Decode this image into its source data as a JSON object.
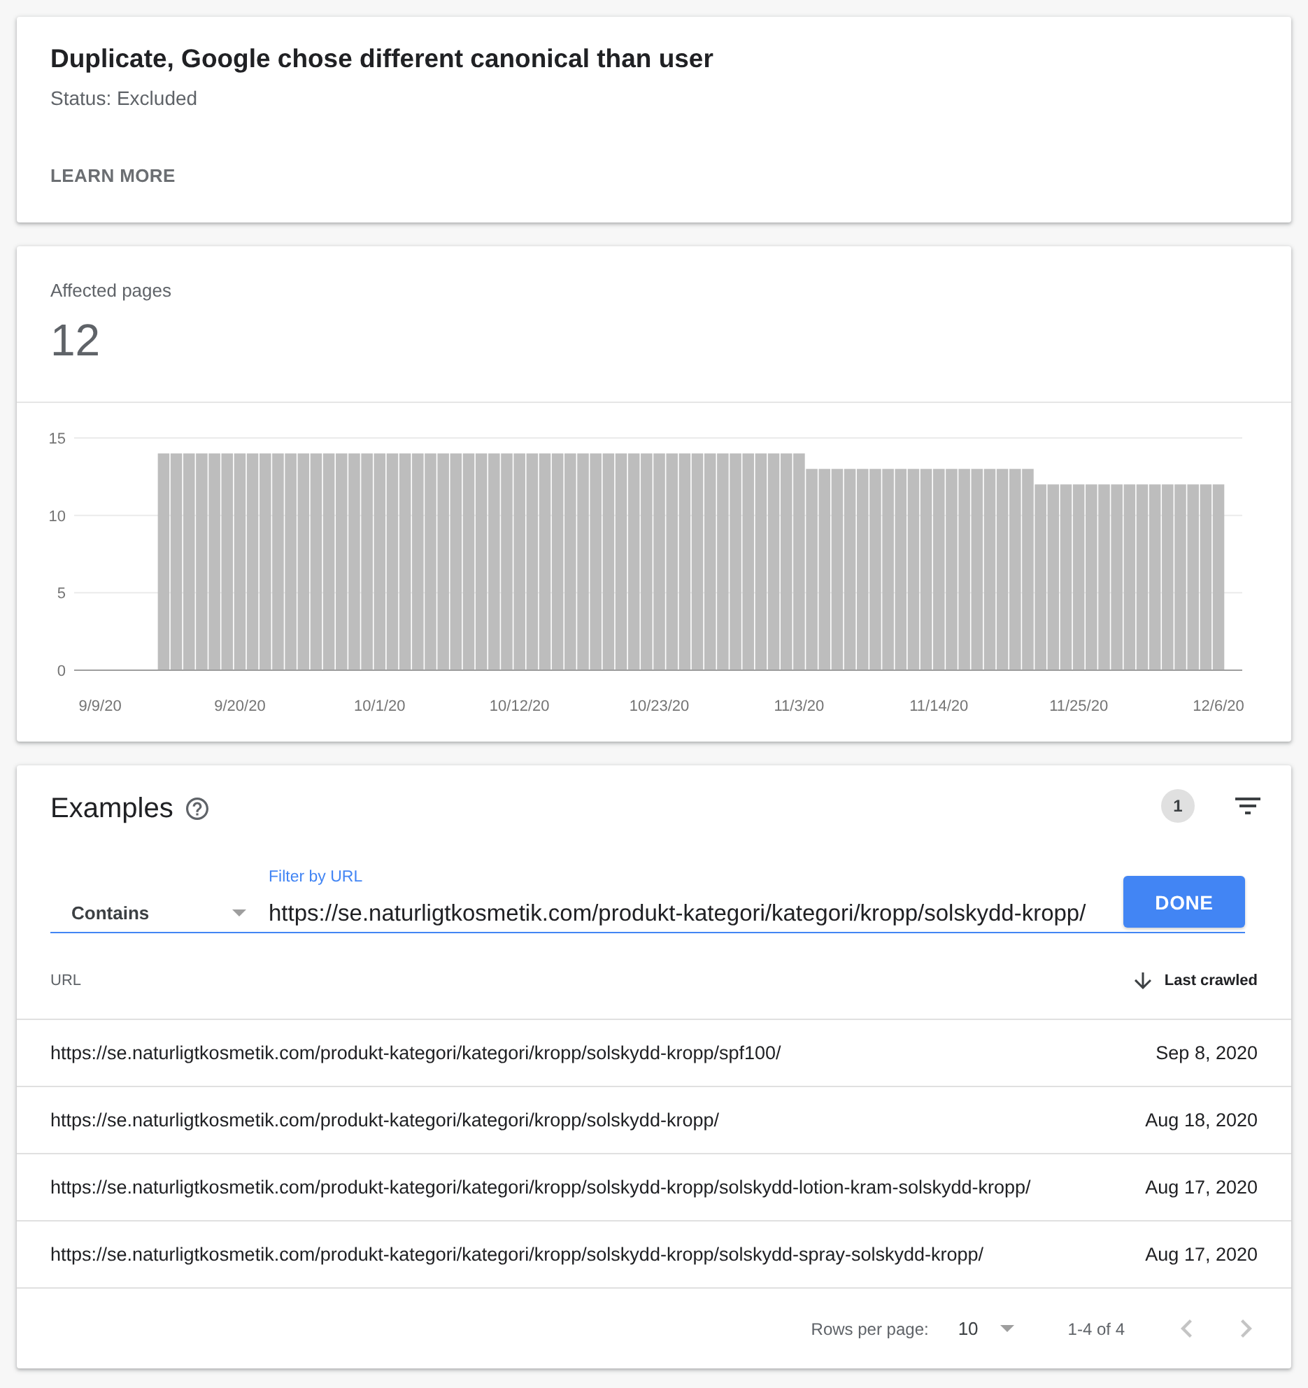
{
  "issue": {
    "title": "Duplicate, Google chose different canonical than user",
    "status": "Status: Excluded",
    "learn_more": "LEARN MORE"
  },
  "affected": {
    "label": "Affected pages",
    "count": "12",
    "chart_data": {
      "type": "bar",
      "categories": [
        "9/9/20",
        null,
        null,
        null,
        null,
        null,
        null,
        null,
        null,
        null,
        null,
        "9/20/20",
        null,
        null,
        null,
        null,
        null,
        null,
        null,
        null,
        null,
        null,
        "10/1/20",
        null,
        null,
        null,
        null,
        null,
        null,
        null,
        null,
        null,
        null,
        "10/12/20",
        null,
        null,
        null,
        null,
        null,
        null,
        null,
        null,
        null,
        null,
        "10/23/20",
        null,
        null,
        null,
        null,
        null,
        null,
        null,
        null,
        null,
        null,
        "11/3/20",
        null,
        null,
        null,
        null,
        null,
        null,
        null,
        null,
        null,
        null,
        "11/14/20",
        null,
        null,
        null,
        null,
        null,
        null,
        null,
        null,
        null,
        null,
        "11/25/20",
        null,
        null,
        null,
        null,
        null,
        null,
        null,
        null,
        null,
        null,
        "12/6/20"
      ],
      "values": [
        null,
        null,
        null,
        null,
        null,
        14,
        14,
        14,
        14,
        14,
        14,
        14,
        14,
        14,
        14,
        14,
        14,
        14,
        14,
        14,
        14,
        14,
        14,
        14,
        14,
        14,
        14,
        14,
        14,
        14,
        14,
        14,
        14,
        14,
        14,
        14,
        14,
        14,
        14,
        14,
        14,
        14,
        14,
        14,
        14,
        14,
        14,
        14,
        14,
        14,
        14,
        14,
        14,
        14,
        14,
        14,
        13,
        13,
        13,
        13,
        13,
        13,
        13,
        13,
        13,
        13,
        13,
        13,
        13,
        13,
        13,
        13,
        13,
        13,
        12,
        12,
        12,
        12,
        12,
        12,
        12,
        12,
        12,
        12,
        12,
        12,
        12,
        12,
        12
      ],
      "ylim": [
        0,
        15
      ],
      "yticks": [
        0,
        5,
        10,
        15
      ]
    }
  },
  "examples": {
    "title": "Examples",
    "filter_count": "1",
    "filter": {
      "operator": "Contains",
      "label": "Filter by URL",
      "value": "https://se.naturligtkosmetik.com/produkt-kategori/kategori/kropp/solskydd-kropp/",
      "focused": true,
      "done": "DONE"
    },
    "table": {
      "columns": [
        {
          "label": "URL",
          "sorted": false
        },
        {
          "label": "Last crawled",
          "sorted": true
        }
      ],
      "rows": [
        {
          "url": "https://se.naturligtkosmetik.com/produkt-kategori/kategori/kropp/solskydd-kropp/spf100/",
          "last_crawled": "Sep 8, 2020"
        },
        {
          "url": "https://se.naturligtkosmetik.com/produkt-kategori/kategori/kropp/solskydd-kropp/",
          "last_crawled": "Aug 18, 2020"
        },
        {
          "url": "https://se.naturligtkosmetik.com/produkt-kategori/kategori/kropp/solskydd-kropp/solskydd-lotion-kram-solskydd-kropp/",
          "last_crawled": "Aug 17, 2020"
        },
        {
          "url": "https://se.naturligtkosmetik.com/produkt-kategori/kategori/kropp/solskydd-kropp/solskydd-spray-solskydd-kropp/",
          "last_crawled": "Aug 17, 2020"
        }
      ]
    },
    "pagination": {
      "rows_per_page_label": "Rows per page:",
      "rows_per_page": "10",
      "range": "1-4 of 4",
      "previous": {
        "disabled": true
      },
      "next": {
        "disabled": true
      }
    }
  }
}
